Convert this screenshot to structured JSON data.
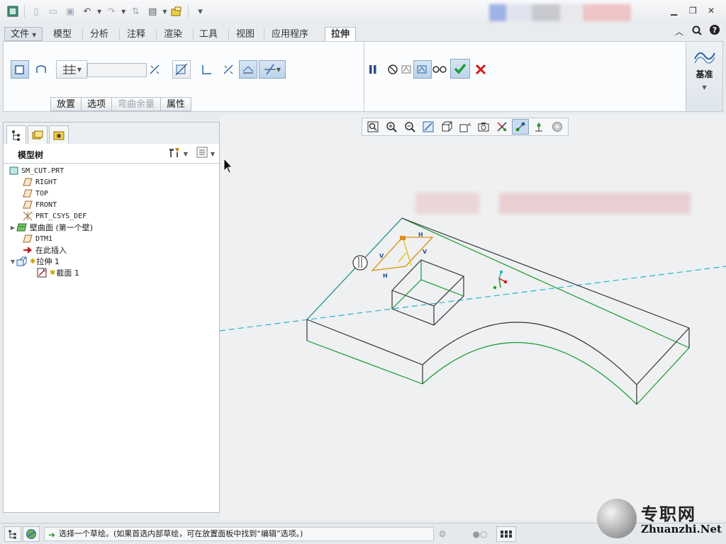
{
  "colors": {
    "accent": "#2a64a8",
    "sketch_orange": "#d9920f",
    "edge_green": "#139a2e",
    "axis_cyan": "#27b3c9",
    "confirm_green": "#1f9d3a",
    "cancel_red": "#d01818"
  },
  "tabs": [
    {
      "label": "文件"
    },
    {
      "label": "模型"
    },
    {
      "label": "分析"
    },
    {
      "label": "注释"
    },
    {
      "label": "渲染"
    },
    {
      "label": "工具"
    },
    {
      "label": "视图"
    },
    {
      "label": "应用程序"
    },
    {
      "label": "拉伸"
    }
  ],
  "ribbon": {
    "subtabs": [
      "放置",
      "选项",
      "弯曲余量",
      "属性"
    ],
    "depth_value": "",
    "datum_label": "基准"
  },
  "tree": {
    "title": "模型树",
    "nodes": [
      {
        "label": "SM_CUT.PRT",
        "icon": "part-icon"
      },
      {
        "label": "RIGHT",
        "icon": "datum-plane-icon"
      },
      {
        "label": "TOP",
        "icon": "datum-plane-icon"
      },
      {
        "label": "FRONT",
        "icon": "datum-plane-icon"
      },
      {
        "label": "PRT_CSYS_DEF",
        "icon": "csys-icon"
      },
      {
        "label": "壁曲面 (第一个壁)",
        "icon": "sheetmetal-wall-icon"
      },
      {
        "label": "DTM1",
        "icon": "datum-plane-icon"
      },
      {
        "label": "在此插入",
        "icon": "insert-here-arrow-icon"
      },
      {
        "label": "拉伸 1",
        "icon": "extrude-icon"
      },
      {
        "label": "截面 1",
        "icon": "sketch-icon"
      }
    ]
  },
  "status": {
    "message": "选择一个草绘。(如果首选内部草绘，可在放置面板中找到“编辑”选项。)"
  },
  "watermark": {
    "cn": "专职网",
    "en": "Zhuanzhi.Net"
  }
}
